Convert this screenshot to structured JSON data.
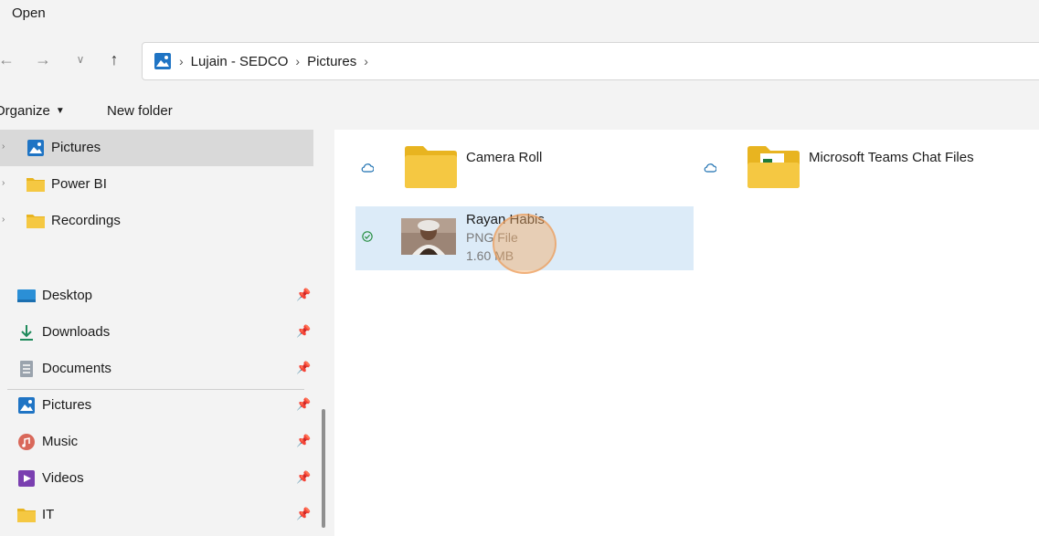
{
  "window": {
    "title": "Open"
  },
  "navigation": {
    "breadcrumb": [
      "Lujain - SEDCO",
      "Pictures"
    ]
  },
  "commands": {
    "organize": "Organize",
    "new_folder": "New folder"
  },
  "sidebar": {
    "tree_items": [
      {
        "label": "Pictures",
        "icon": "pictures-icon",
        "selected": true
      },
      {
        "label": "Power BI",
        "icon": "folder-icon"
      },
      {
        "label": "Recordings",
        "icon": "folder-icon"
      }
    ],
    "quick_access": [
      {
        "label": "Desktop",
        "icon": "desktop-icon"
      },
      {
        "label": "Downloads",
        "icon": "downloads-icon"
      },
      {
        "label": "Documents",
        "icon": "documents-icon"
      },
      {
        "label": "Pictures",
        "icon": "pictures-icon"
      },
      {
        "label": "Music",
        "icon": "music-icon"
      },
      {
        "label": "Videos",
        "icon": "videos-icon"
      },
      {
        "label": "IT",
        "icon": "folder-icon"
      }
    ]
  },
  "files": [
    {
      "name": "Camera Roll",
      "status": "cloud-icon",
      "icon": "folder-icon"
    },
    {
      "name": "Microsoft Teams Chat Files",
      "status": "cloud-icon",
      "icon": "folder-icon"
    },
    {
      "name": "Rayan Habis",
      "type": "PNG File",
      "size": "1.60 MB",
      "status": "synced-check-icon",
      "selected": true
    }
  ],
  "colors": {
    "folder": "#f5c842",
    "folder_dark": "#e8b420",
    "selection": "#dcebf8",
    "sidebar_selected": "#d9d9d9",
    "accent": "#1f74c4"
  }
}
